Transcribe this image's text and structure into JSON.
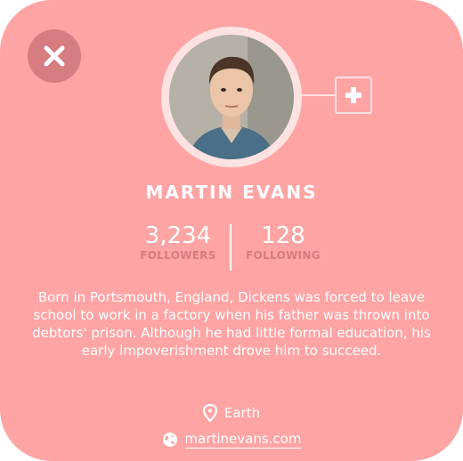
{
  "profile": {
    "name": "MARTIN EVANS",
    "followers_count": "3,234",
    "followers_label": "FOLLOWERS",
    "following_count": "128",
    "following_label": "FOLLOWING",
    "bio": "Born in Portsmouth, England, Dickens was forced to leave school to work in a factory when his father was thrown into debtors' prison. Although he had little formal education, his early impoverishment drove him to succeed.",
    "location": "Earth",
    "website": "martinevans.com"
  },
  "icons": {
    "close": "close-icon",
    "add": "plus-icon",
    "location": "map-pin-icon",
    "website": "globe-icon"
  },
  "colors": {
    "card_background": "#fea4a4",
    "accent": "#d77c80",
    "ring": "#fde2e2",
    "text": "#ffffff"
  }
}
